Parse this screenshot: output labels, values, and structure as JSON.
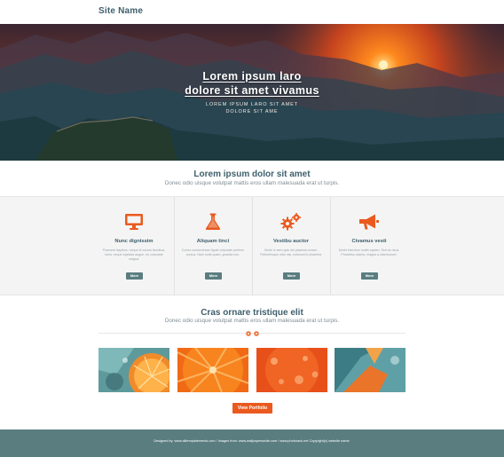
{
  "header": {
    "site_name": "Site Name"
  },
  "hero": {
    "title_line1": "Lorem ipsum laro",
    "title_line2": "dolore sit amet vivamus",
    "sub_line1": "LOREM IPSUM LARO SIT AMET",
    "sub_line2": "DOLORE SIT AME"
  },
  "intro": {
    "title": "Lorem ipsum dolor sit amet",
    "subtitle": "Donec odio uisque volutpat mattis eros ullam malesuada erat ut turpis."
  },
  "features": [
    {
      "icon": "monitor-icon",
      "title": "Nunc dignissim",
      "text": "Praesent dapibus, neque id cursus faucibus, tortor neque egestas augue, eu vulputate magna.",
      "button": "More"
    },
    {
      "icon": "flask-icon",
      "title": "Aliquam tinci",
      "text": "Donec consectetuer ligula vulputate pretium cursus. Nam nulla quam, gravida non.",
      "button": "More"
    },
    {
      "icon": "gears-icon",
      "title": "Vestibu auctor",
      "text": "Morbi in sem quis dui placerat ornare. Pellentesque odio nisi, euismod in pharetra.",
      "button": "More"
    },
    {
      "icon": "megaphone-icon",
      "title": "Civamus vesti",
      "text": "Morbi interdum mollis sapien. Sed ac risus. Phasellus lacinia, magna a ullamcorper.",
      "button": "More"
    }
  ],
  "portfolio": {
    "title": "Cras ornare tristique elit",
    "subtitle": "Donec odio uisque volutpat mattis eros ullam malesuada erat ut turpis.",
    "button": "View Portfolio"
  },
  "footer": {
    "text": "Designed by: www.alltemplateneeds.com / Images from: www.wallpaperswide.com / www.photorack.net Copyright(c) website name."
  },
  "colors": {
    "accent": "#ea5a1f",
    "heading": "#3e5f6c",
    "footer_bg": "#5a7d80"
  }
}
